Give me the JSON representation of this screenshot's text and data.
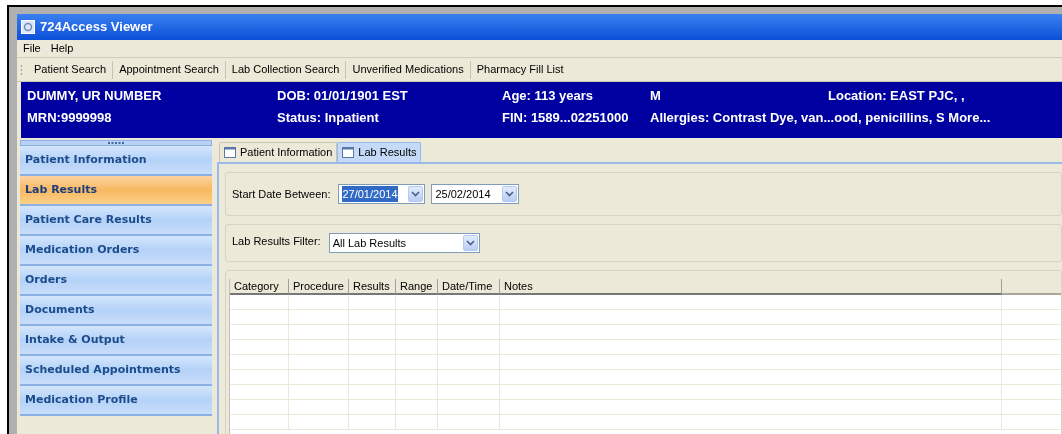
{
  "window": {
    "title": "724Access Viewer"
  },
  "menu": [
    "File",
    "Help"
  ],
  "toolbar": [
    "Patient Search",
    "Appointment Search",
    "Lab Collection Search",
    "Unverified Medications",
    "Pharmacy Fill List"
  ],
  "patient_banner": {
    "name": "DUMMY, UR NUMBER",
    "dob": "DOB: 01/01/1901 EST",
    "age": "Age: 113 years",
    "sex": "M",
    "location": "Location: EAST PJC, ,",
    "mrn": "MRN:9999998",
    "status": "Status: Inpatient",
    "fin": "FIN: 1589...02251000",
    "allergies": "Allergies: Contrast Dye, van...ood, penicillins, S More..."
  },
  "sidebar": {
    "items": [
      {
        "label": "Patient Information",
        "selected": false
      },
      {
        "label": "Lab Results",
        "selected": true
      },
      {
        "label": "Patient Care Results",
        "selected": false
      },
      {
        "label": "Medication Orders",
        "selected": false
      },
      {
        "label": "Orders",
        "selected": false
      },
      {
        "label": "Documents",
        "selected": false
      },
      {
        "label": "Intake & Output",
        "selected": false
      },
      {
        "label": "Scheduled Appointments",
        "selected": false
      },
      {
        "label": "Medication Profile",
        "selected": false
      }
    ]
  },
  "tabs": [
    {
      "label": "Patient Information",
      "selected": false
    },
    {
      "label": "Lab Results",
      "selected": true
    }
  ],
  "date_range": {
    "label": "Start Date Between:",
    "start": {
      "value": "27/01/2014",
      "text_selected": true
    },
    "end": {
      "value": "25/02/2014",
      "text_selected": false
    }
  },
  "filter": {
    "label": "Lab Results Filter:",
    "value": "All Lab Results"
  },
  "table": {
    "columns": [
      "Category",
      "Procedure",
      "Results",
      "Range",
      "Date/Time",
      "Notes"
    ]
  }
}
